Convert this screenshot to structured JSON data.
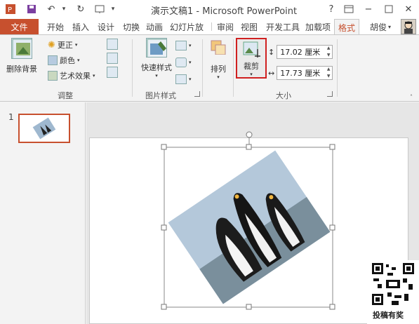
{
  "app": {
    "title": "演示文稿1 - Microsoft PowerPoint",
    "help": "?",
    "user": "胡俊"
  },
  "tabs": [
    {
      "label": "文件"
    },
    {
      "label": "开始"
    },
    {
      "label": "插入"
    },
    {
      "label": "设计"
    },
    {
      "label": "切换"
    },
    {
      "label": "动画"
    },
    {
      "label": "幻灯片放"
    },
    {
      "label": "审阅"
    },
    {
      "label": "视图"
    },
    {
      "label": "开发工具"
    },
    {
      "label": "加载项"
    },
    {
      "label": "格式"
    }
  ],
  "ribbon": {
    "remove_bg": "删除背景",
    "corrections": "更正",
    "color": "颜色",
    "artistic": "艺术效果",
    "group_adjust": "调整",
    "quick_styles": "快速样式",
    "group_picture_styles": "图片样式",
    "arrange": "排列",
    "crop": "裁剪",
    "height_value": "17.02 厘米",
    "width_value": "17.73 厘米",
    "group_size": "大小"
  },
  "thumbs": {
    "slide_number": "1"
  },
  "watermark": {
    "label": "投稿有奖"
  },
  "colors": {
    "accent": "#c7502e",
    "crop_highlight": "#d02020"
  }
}
